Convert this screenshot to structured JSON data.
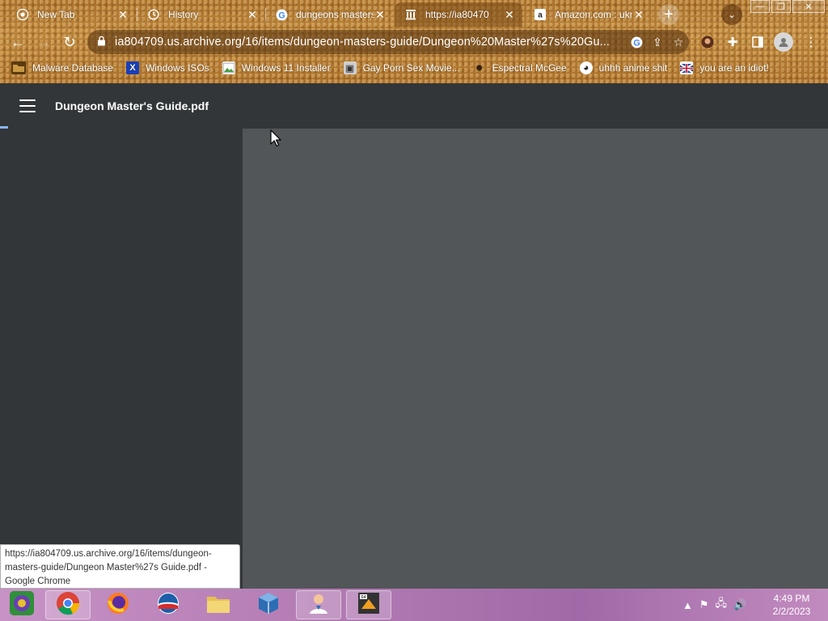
{
  "browser": {
    "tabs": [
      {
        "title": "New Tab",
        "icon": "chrome-icon",
        "active": false
      },
      {
        "title": "History",
        "icon": "history-icon",
        "active": false
      },
      {
        "title": "dungeons masters",
        "icon": "google-icon",
        "active": false
      },
      {
        "title": "https://ia80470",
        "icon": "archive-icon",
        "active": true
      },
      {
        "title": "Amazon.com : ukn",
        "icon": "amazon-icon",
        "active": false
      }
    ],
    "url": "ia804709.us.archive.org/16/items/dungeon-masters-guide/Dungeon%20Master%27s%20Gu...",
    "bookmarks": [
      {
        "label": "Malware Database",
        "icon": "malware-folder-icon"
      },
      {
        "label": "Windows ISOs",
        "icon": "x-icon"
      },
      {
        "label": "Windows 11 Installer",
        "icon": "image-icon"
      },
      {
        "label": "Gay Porn Sex Movie...",
        "icon": "pixel-icon"
      },
      {
        "label": "Espectral McGee",
        "icon": "character-icon"
      },
      {
        "label": "uhhh anime shit",
        "icon": "anime-face-icon"
      },
      {
        "label": "you are an idiot!",
        "icon": "flag-icon"
      }
    ]
  },
  "viewer": {
    "title": "Dungeon Master's Guide.pdf"
  },
  "status_tip": "https://ia804709.us.archive.org/16/items/dungeon-masters-guide/Dungeon Master%27s Guide.pdf - Google Chrome",
  "taskbar": {
    "time": "4:49 PM",
    "date": "2/2/2023"
  },
  "colors": {
    "chrome_theme": "#b07a34",
    "viewer_bar": "#323639",
    "viewer_bg": "#525659",
    "taskbar": "#b27bb3"
  }
}
